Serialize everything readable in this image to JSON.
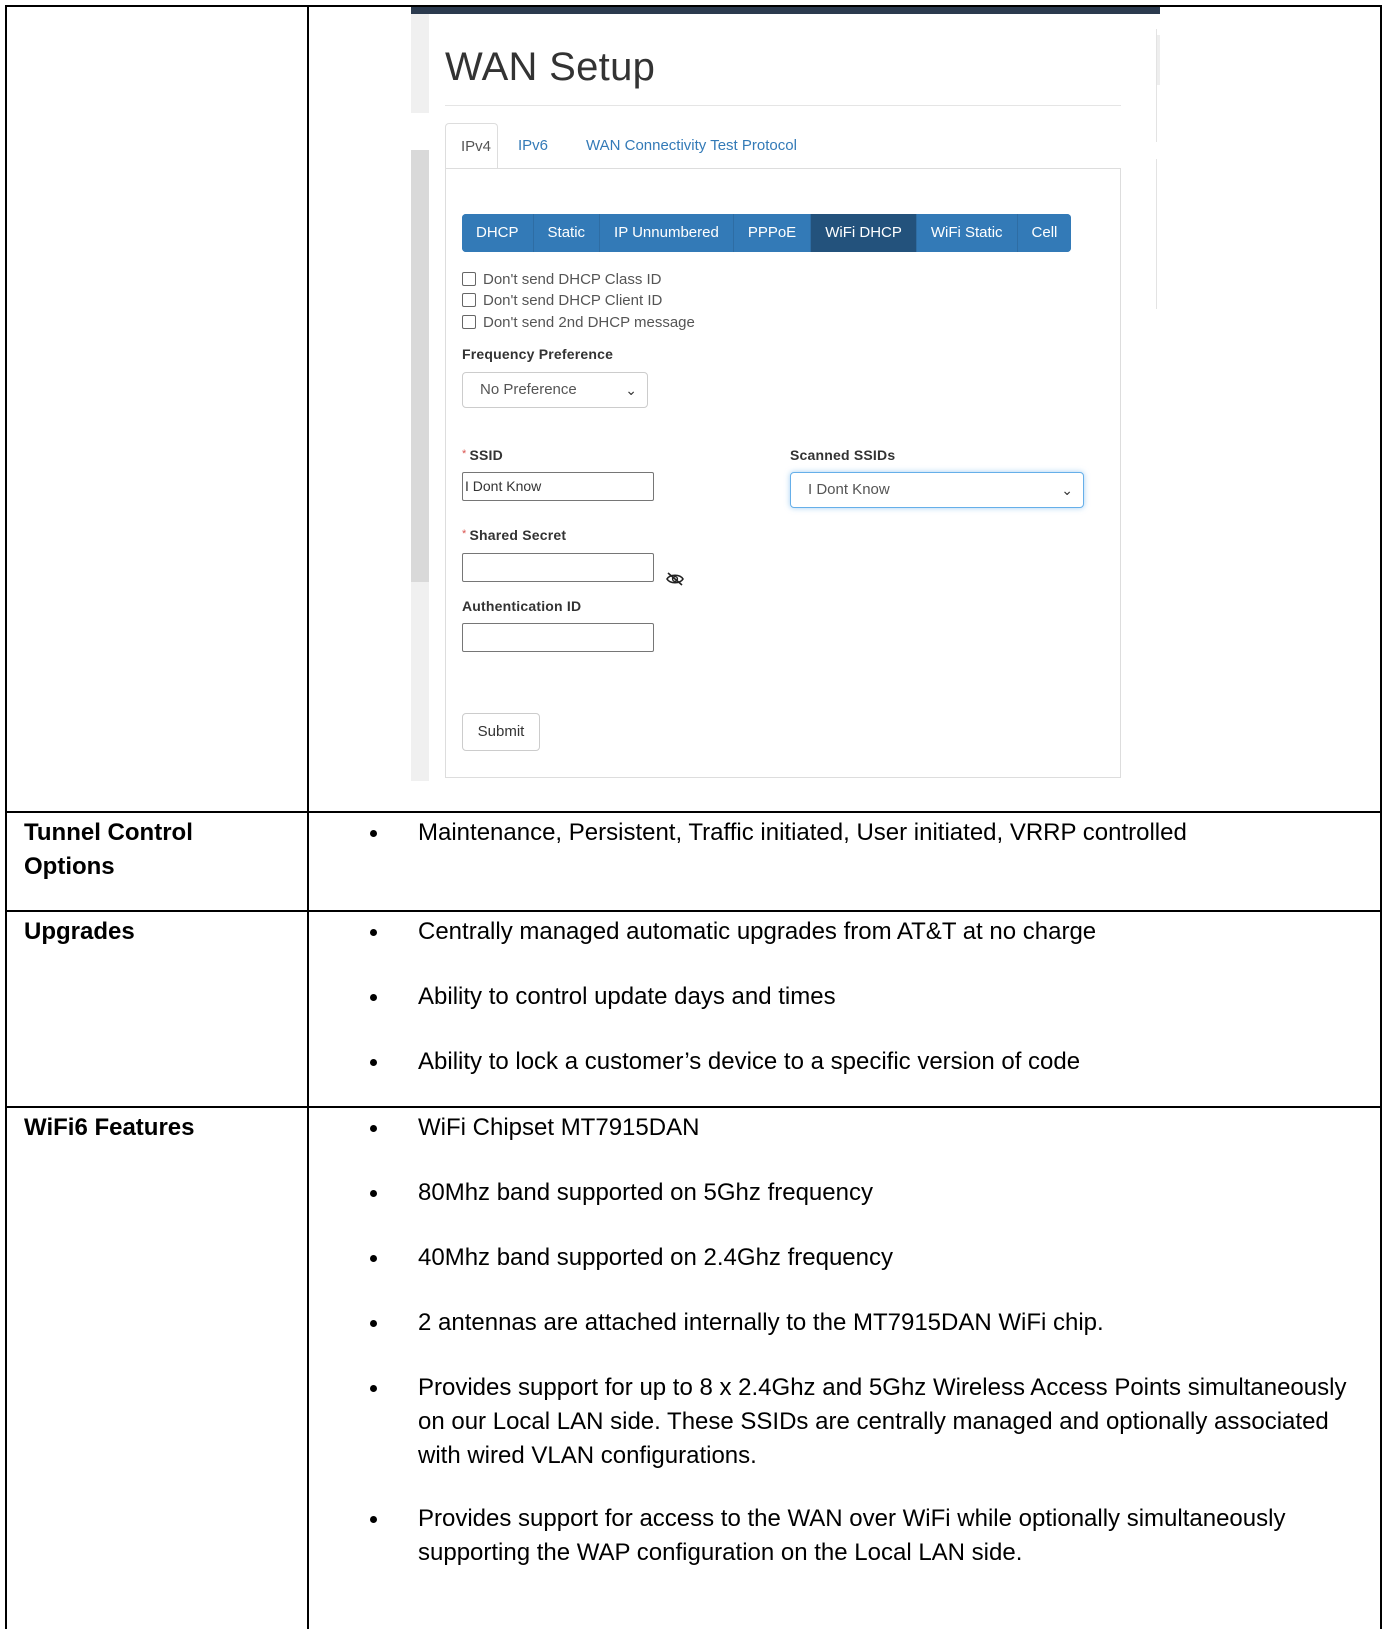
{
  "screenshot": {
    "page_title": "WAN Setup",
    "tabs": [
      {
        "label": "IPv4",
        "active": true
      },
      {
        "label": "IPv6",
        "active": false
      },
      {
        "label": "WAN Connectivity Test Protocol",
        "active": false
      }
    ],
    "mode_buttons": [
      {
        "label": "DHCP",
        "active": false
      },
      {
        "label": "Static",
        "active": false
      },
      {
        "label": "IP Unnumbered",
        "active": false
      },
      {
        "label": "PPPoE",
        "active": false
      },
      {
        "label": "WiFi DHCP",
        "active": true
      },
      {
        "label": "WiFi Static",
        "active": false
      },
      {
        "label": "Cell",
        "active": false
      }
    ],
    "checkboxes": [
      {
        "label": "Don't send DHCP Class ID",
        "checked": false
      },
      {
        "label": "Don't send DHCP Client ID",
        "checked": false
      },
      {
        "label": "Don't send 2nd DHCP message",
        "checked": false
      }
    ],
    "frequency_label": "Frequency Preference",
    "frequency_value": "No Preference",
    "ssid_required_mark": "*",
    "ssid_label": "SSID",
    "ssid_value": "I Dont Know",
    "scanned_label": "Scanned SSIDs",
    "scanned_value": "I Dont Know",
    "secret_required_mark": "*",
    "secret_label": "Shared Secret",
    "secret_value": "",
    "auth_label": "Authentication ID",
    "auth_value": "",
    "submit_label": "Submit",
    "colors": {
      "primary": "#337ab7",
      "primary_active": "#23527c",
      "required": "#d9534f",
      "topbar": "#2b3a4e"
    }
  },
  "rows": [
    {
      "label": "Tunnel Control Options",
      "bullets": [
        "Maintenance, Persistent, Traffic initiated, User initiated, VRRP controlled"
      ]
    },
    {
      "label": "Upgrades",
      "bullets": [
        "Centrally managed automatic upgrades from AT&T at no charge",
        "Ability to control update days and times",
        "Ability to lock a customer’s device to a specific version of code"
      ]
    },
    {
      "label": "WiFi6 Features",
      "bullets": [
        "WiFi Chipset MT7915DAN",
        "80Mhz band supported on 5Ghz frequency",
        "40Mhz band supported on 2.4Ghz frequency",
        "2 antennas are attached internally to the MT7915DAN WiFi chip.",
        "Provides support for up to 8 x 2.4Ghz and 5Ghz Wireless Access Points simultaneously on our Local LAN side.  These SSIDs are centrally managed and optionally associated with wired VLAN configurations.",
        "Provides support for access to the WAN over WiFi while optionally simultaneously supporting the WAP configuration on the Local LAN side."
      ]
    }
  ]
}
